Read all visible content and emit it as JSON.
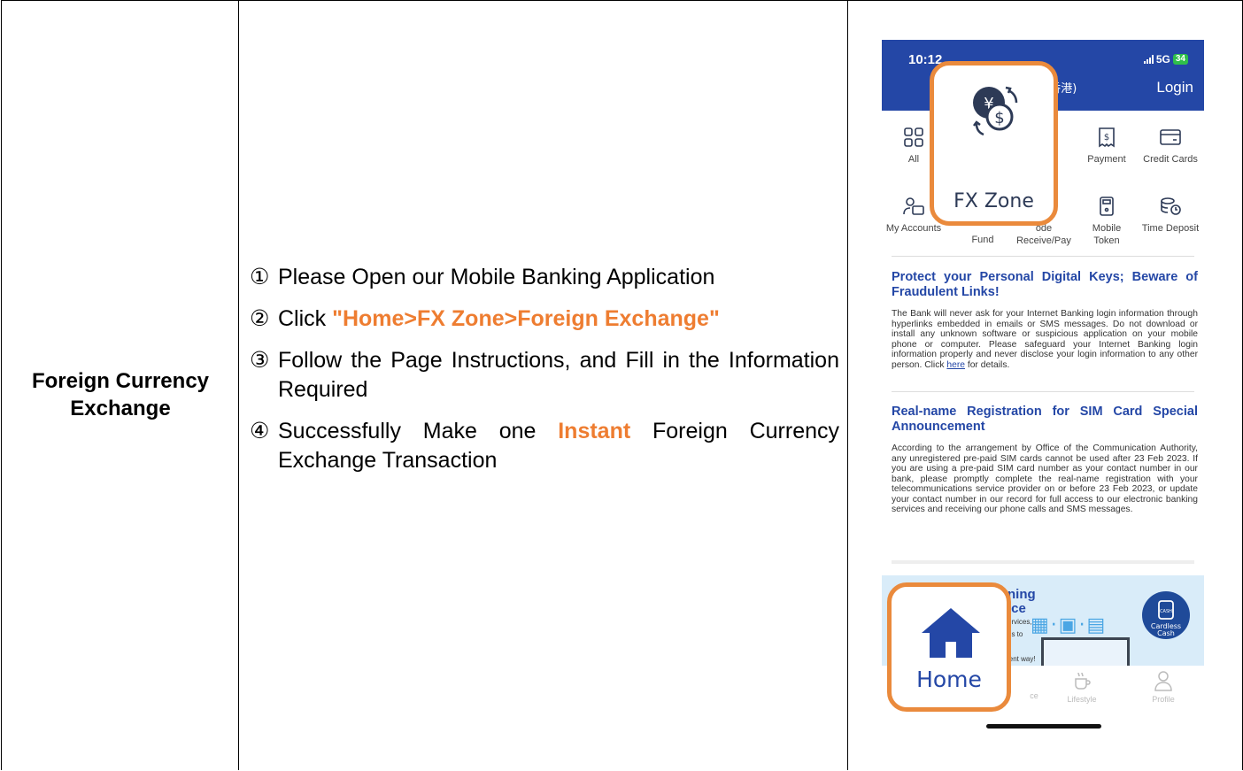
{
  "left_cell": {
    "title": "Foreign Currency Exchange"
  },
  "steps": [
    {
      "num": "①",
      "text": "Please Open our Mobile Banking Application"
    },
    {
      "num": "②",
      "before": "Click ",
      "highlight": "\"Home>FX Zone>Foreign Exchange\"",
      "after": ""
    },
    {
      "num": "③",
      "text": "Follow the Page Instructions, and Fill in the Information Required"
    },
    {
      "num": "④",
      "before": "Successfully Make one ",
      "highlight": "Instant",
      "after": " Foreign Currency Exchange Transaction"
    }
  ],
  "phone": {
    "status": {
      "time": "10:12",
      "network": "5G",
      "battery": "34"
    },
    "header": {
      "bank_name": "交通銀行 (香港)",
      "login": "Login"
    },
    "tiles": {
      "all": "All",
      "fx_zone": "FX Zone",
      "payment": "Payment",
      "credit_cards": "Credit Cards",
      "my_accounts": "My Accounts",
      "fund": "Fund",
      "code_receive_pay": "ode Receive/Pay",
      "mobile_token": "Mobile Token",
      "time_deposit": "Time Deposit"
    },
    "notice1": {
      "title": "Protect your Personal Digital Keys; Beware of Fraudulent Links!",
      "body": "The Bank will never ask for your Internet Banking login information through hyperlinks embedded in emails or SMS messages. Do not download or install any unknown software or suspicious application on your mobile phone or computer. Please safeguard your Internet Banking login information properly and never disclose your login information to any other person. Click ",
      "link": "here",
      "tail": " for details."
    },
    "notice2": {
      "title": "Real-name Registration for SIM Card Special Announcement",
      "body": "According to the arrangement by Office of the Communication Authority, any unregistered pre-paid SIM cards cannot be used after 23 Feb 2023. If you are using a pre-paid SIM card number as your contact number in our bank, please promptly complete the real-name registration with your telecommunications service provider on or before 23 Feb 2023, or update your contact number in our record for full access to our electronic banking services and receiving our phone calls and SMS messages."
    },
    "banner": {
      "title_line1": "ning",
      "title_line2": "ice",
      "text1": "ervices,",
      "text2": "us to",
      "text3": "ient way!",
      "cardless": "Cardless Cash",
      "cash_badge": "CASH"
    },
    "tabbar": {
      "home": "Home",
      "service": "ce",
      "lifestyle": "Lifestyle",
      "profile": "Profile"
    }
  },
  "colors": {
    "highlight": "#ee7d31",
    "bank_blue": "#2447a6",
    "frame_orange": "#ea8a3c"
  }
}
